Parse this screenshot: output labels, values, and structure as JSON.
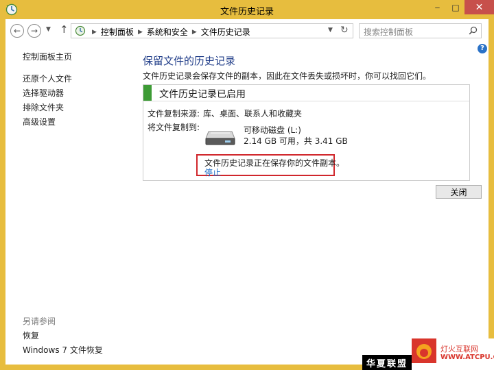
{
  "window": {
    "title": "文件历史记录",
    "controls": {
      "minimize": "‒",
      "maximize": "□",
      "close": "✕"
    }
  },
  "navbar": {
    "breadcrumbs": [
      "控制面板",
      "系统和安全",
      "文件历史记录"
    ],
    "search_placeholder": "搜索控制面板"
  },
  "sidebar": {
    "items": [
      {
        "label": "控制面板主页"
      },
      {
        "label": "还原个人文件"
      },
      {
        "label": "选择驱动器"
      },
      {
        "label": "排除文件夹"
      },
      {
        "label": "高级设置"
      }
    ],
    "see_also_title": "另请参阅",
    "see_also": [
      {
        "label": "恢复"
      },
      {
        "label": "Windows 7 文件恢复"
      }
    ]
  },
  "main": {
    "heading": "保留文件的历史记录",
    "description": "文件历史记录会保存文件的副本，因此在文件丢失或损坏时，你可以找回它们。",
    "panel": {
      "title": "文件历史记录已启用",
      "status_color": "#3d9b35",
      "copy_from_label": "文件复制来源:",
      "copy_from_value": "库、桌面、联系人和收藏夹",
      "copy_to_label": "将文件复制到:",
      "drive_name": "可移动磁盘 (L:)",
      "drive_space": "2.14 GB 可用，共 3.41 GB",
      "status_message": "文件历史记录正在保存你的文件副本。",
      "stop_link": "停止"
    },
    "close_button": "关闭",
    "help_icon": "?"
  },
  "watermark": {
    "black_text": "华夏联盟",
    "cn_text": "灯火互联网",
    "en_text": "WWW.ATCPU.COM"
  },
  "colors": {
    "window_frame": "#e7bd3e",
    "close_button": "#c7504b",
    "heading": "#1f3c88",
    "link": "#1a6bc7",
    "highlight_border": "#d0262b"
  }
}
